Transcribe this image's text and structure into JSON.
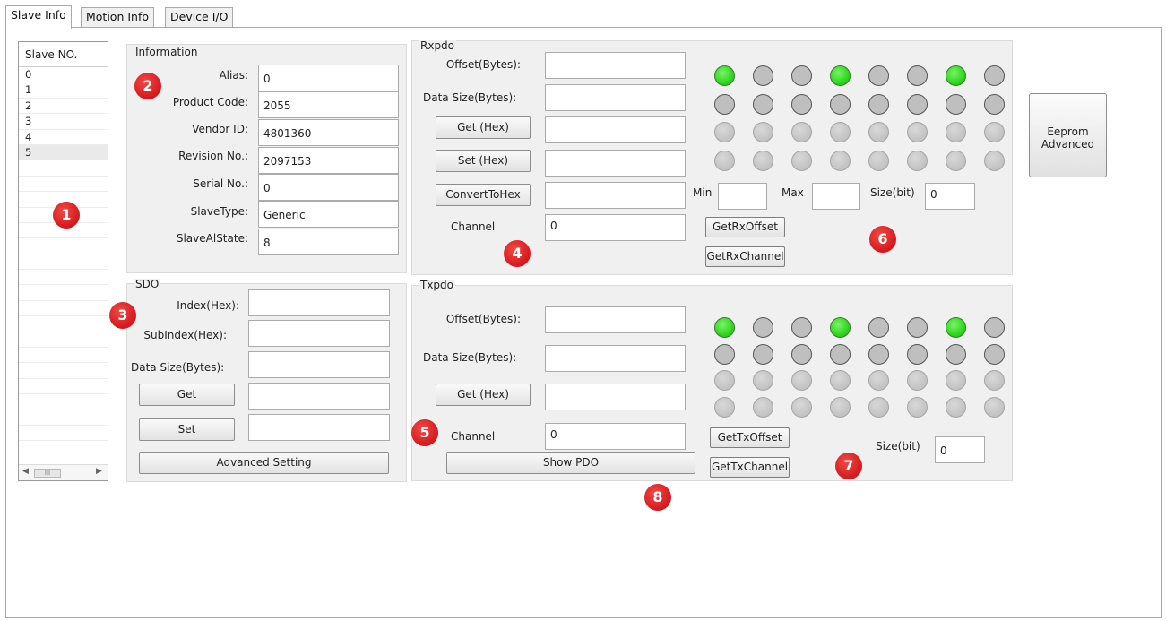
{
  "tabs": [
    {
      "label": "Slave Info"
    },
    {
      "label": "Motion Info"
    },
    {
      "label": "Device I/O"
    }
  ],
  "slave_list": {
    "header": "Slave NO.",
    "items": [
      "0",
      "1",
      "2",
      "3",
      "4",
      "5"
    ],
    "selected": "5",
    "scroll_thumb": "III"
  },
  "information": {
    "title": "Information",
    "fields": [
      {
        "label": "Alias:",
        "value": "0"
      },
      {
        "label": "Product Code:",
        "value": "2055"
      },
      {
        "label": "Vendor ID:",
        "value": "4801360"
      },
      {
        "label": "Revision No.:",
        "value": "2097153"
      },
      {
        "label": "Serial No.:",
        "value": "0"
      },
      {
        "label": "SlaveType:",
        "value": "Generic"
      },
      {
        "label": "SlaveAlState:",
        "value": "8"
      }
    ]
  },
  "sdo": {
    "title": "SDO",
    "index_label": "Index(Hex):",
    "index_value": "",
    "subindex_label": "SubIndex(Hex):",
    "subindex_value": "",
    "datasize_label": "Data Size(Bytes):",
    "datasize_value": "",
    "get_label": "Get",
    "get_value": "",
    "set_label": "Set",
    "set_value": "",
    "advanced_label": "Advanced Setting"
  },
  "rxpdo": {
    "title": "Rxpdo",
    "offset_label": "Offset(Bytes):",
    "offset_value": "",
    "datasize_label": "Data Size(Bytes):",
    "datasize_value": "",
    "get_hex_label": "Get (Hex)",
    "get_hex_value": "",
    "set_hex_label": "Set (Hex)",
    "set_hex_value": "",
    "convert_label": "ConvertToHex",
    "convert_value": "",
    "channel_label": "Channel",
    "channel_value": "0",
    "min_label": "Min",
    "min_value": "",
    "max_label": "Max",
    "max_value": "",
    "sizebit_label": "Size(bit)",
    "sizebit_value": "0",
    "get_offset_label": "GetRxOffset",
    "get_channel_label": "GetRxChannel",
    "led_rows": [
      [
        1,
        0,
        0,
        1,
        0,
        0,
        1,
        0
      ],
      [
        0,
        0,
        0,
        0,
        0,
        0,
        0,
        0
      ],
      [
        2,
        2,
        2,
        2,
        2,
        2,
        2,
        2
      ],
      [
        2,
        2,
        2,
        2,
        2,
        2,
        2,
        2
      ]
    ]
  },
  "txpdo": {
    "title": "Txpdo",
    "offset_label": "Offset(Bytes):",
    "offset_value": "",
    "datasize_label": "Data Size(Bytes):",
    "datasize_value": "",
    "get_hex_label": "Get (Hex)",
    "get_hex_value": "",
    "channel_label": "Channel",
    "channel_value": "0",
    "show_pdo_label": "Show PDO",
    "sizebit_label": "Size(bit)",
    "sizebit_value": "0",
    "get_offset_label": "GetTxOffset",
    "get_channel_label": "GetTxChannel",
    "led_rows": [
      [
        1,
        0,
        0,
        1,
        0,
        0,
        1,
        0
      ],
      [
        0,
        0,
        0,
        0,
        0,
        0,
        0,
        0
      ],
      [
        2,
        2,
        2,
        2,
        2,
        2,
        2,
        2
      ],
      [
        2,
        2,
        2,
        2,
        2,
        2,
        2,
        2
      ]
    ]
  },
  "eeprom": {
    "line1": "Eeprom",
    "line2": "Advanced"
  },
  "badges": [
    "1",
    "2",
    "3",
    "4",
    "5",
    "6",
    "7",
    "8"
  ],
  "colors": {
    "led_on": "#2ed81d",
    "led_off": "#bfbfbf",
    "badge": "#d6171b"
  }
}
